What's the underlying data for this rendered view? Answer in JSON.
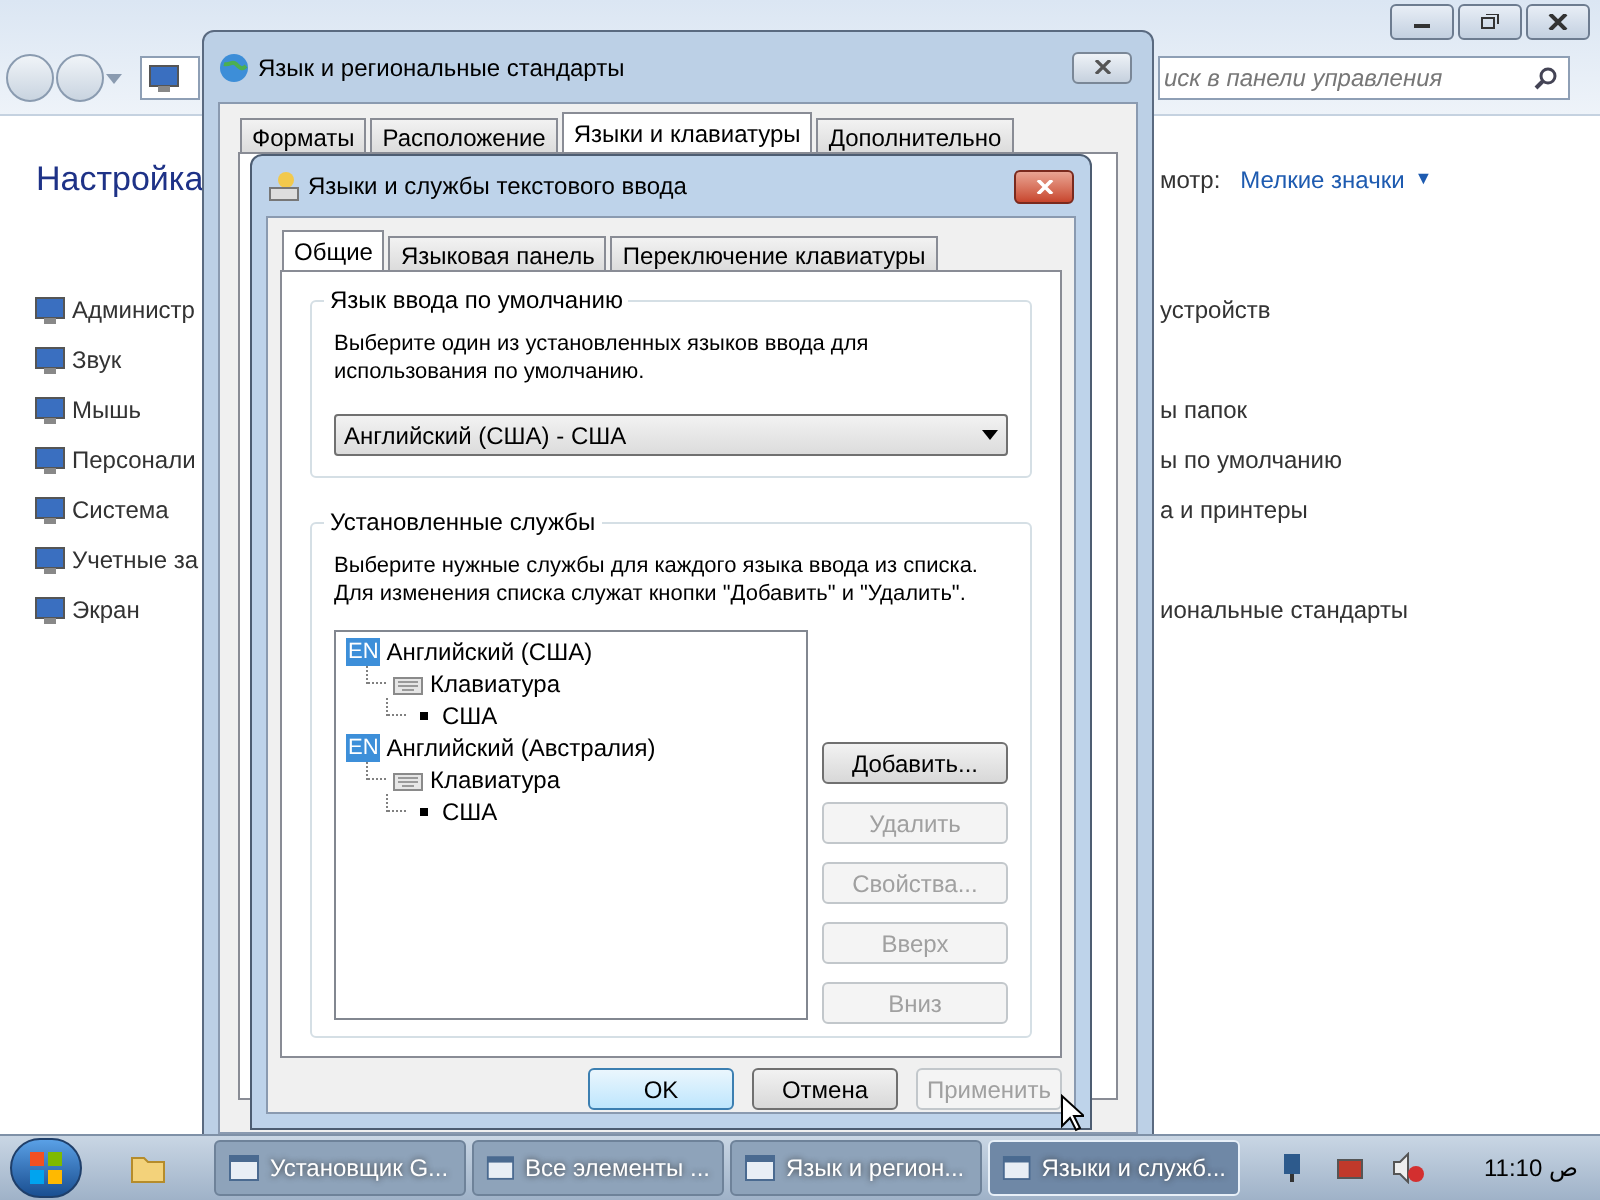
{
  "control_panel": {
    "search": {
      "placeholder": "иск в панели управления"
    },
    "heading": "Настройка",
    "view_label": "мотр:",
    "view_value": "Мелкие значки",
    "view_caret": "▼",
    "left_items": [
      "Администр",
      "Звук",
      "Мышь",
      "Персонали",
      "Система",
      "Учетные за",
      "Экран"
    ],
    "right_items": [
      "устройств",
      "ы папок",
      "ы по умолчанию",
      "а и принтеры",
      "иональные стандарты"
    ]
  },
  "region_window": {
    "title": "Язык и региональные стандарты",
    "tabs": [
      {
        "label": "Форматы",
        "selected": false
      },
      {
        "label": "Расположение",
        "selected": false
      },
      {
        "label": "Языки и клавиатуры",
        "selected": true
      },
      {
        "label": "Дополнительно",
        "selected": false
      }
    ]
  },
  "text_services_dialog": {
    "title": "Языки и службы текстового ввода",
    "tabs": [
      {
        "label": "Общие",
        "selected": true
      },
      {
        "label": "Языковая панель",
        "selected": false
      },
      {
        "label": "Переключение клавиатуры",
        "selected": false
      }
    ],
    "default_language": {
      "group_title": "Язык ввода по умолчанию",
      "description": "Выберите один из установленных языков ввода для использования по умолчанию.",
      "value": "Английский (США) - США"
    },
    "installed_services": {
      "group_title": "Установленные службы",
      "description": "Выберите нужные службы для каждого языка ввода из списка. Для изменения списка служат кнопки \"Добавить\" и \"Удалить\".",
      "tree": [
        {
          "kind": "language",
          "code": "EN",
          "label": "Английский (США)",
          "children": [
            {
              "kind": "category",
              "label": "Клавиатура",
              "children": [
                {
                  "kind": "layout",
                  "label": "США"
                }
              ]
            }
          ]
        },
        {
          "kind": "language",
          "code": "EN",
          "label": "Английский (Австралия)",
          "children": [
            {
              "kind": "category",
              "label": "Клавиатура",
              "children": [
                {
                  "kind": "layout",
                  "label": "США"
                }
              ]
            }
          ]
        }
      ],
      "buttons": [
        {
          "label": "Добавить...",
          "disabled": false
        },
        {
          "label": "Удалить",
          "disabled": true
        },
        {
          "label": "Свойства...",
          "disabled": true
        },
        {
          "label": "Вверх",
          "disabled": true
        },
        {
          "label": "Вниз",
          "disabled": true
        }
      ]
    },
    "footer_buttons": [
      {
        "label": "OK",
        "disabled": false
      },
      {
        "label": "Отмена",
        "disabled": false
      },
      {
        "label": "Применить",
        "disabled": true
      }
    ]
  },
  "taskbar": {
    "tasks": [
      {
        "label": "Установщик G...",
        "selected": false
      },
      {
        "label": "Все элементы ...",
        "selected": false
      },
      {
        "label": "Язык и регион...",
        "selected": false
      },
      {
        "label": "Языки и служб...",
        "selected": true
      }
    ],
    "clock": "11:10 ص"
  }
}
